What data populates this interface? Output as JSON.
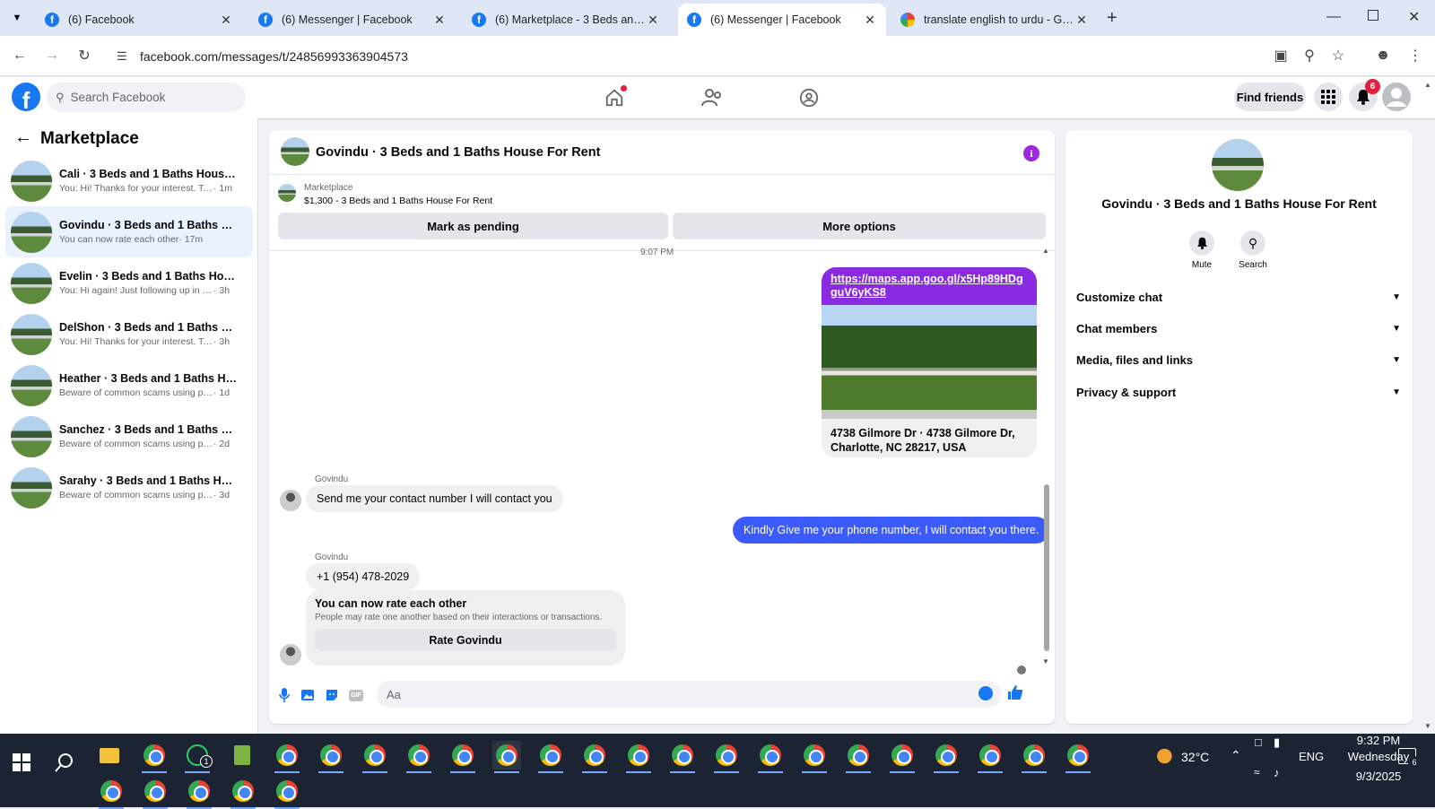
{
  "browser": {
    "tabs": [
      {
        "title": "(6) Facebook",
        "icon": "facebook-icon"
      },
      {
        "title": "(6) Messenger | Facebook",
        "icon": "facebook-icon"
      },
      {
        "title": "(6) Marketplace - 3 Beds and 1",
        "icon": "facebook-icon"
      },
      {
        "title": "(6) Messenger | Facebook",
        "icon": "facebook-icon",
        "active": true
      },
      {
        "title": "translate english to urdu - Goog",
        "icon": "google-icon"
      }
    ],
    "url": "facebook.com/messages/t/24856993363904573"
  },
  "fb_header": {
    "search_placeholder": "Search Facebook",
    "find_friends": "Find friends",
    "notification_count": "6"
  },
  "left_panel": {
    "title": "Marketplace",
    "conversations": [
      {
        "name": "Cali · 3 Beds and 1 Baths House For Rent",
        "preview": "You: Hi! Thanks for your interest. To s...",
        "time": "· 1m"
      },
      {
        "name": "Govindu · 3 Beds and 1 Baths House For Rent",
        "preview": "You can now rate each other",
        "time": "· 17m"
      },
      {
        "name": "Evelin · 3 Beds and 1 Baths House For Rent",
        "preview": "You: Hi again! Just following up in cas...",
        "time": "· 3h"
      },
      {
        "name": "DelShon · 3 Beds and 1 Baths House For Rent",
        "preview": "You: Hi! Thanks for your interest. To sh...",
        "time": "· 3h"
      },
      {
        "name": "Heather · 3 Beds and 1 Baths House For Rent",
        "preview": "Beware of common scams using pay...",
        "time": "· 1d"
      },
      {
        "name": "Sanchez · 3 Beds and 1 Baths House For Rent",
        "preview": "Beware of common scams using pay...",
        "time": "· 2d"
      },
      {
        "name": "Sarahy · 3 Beds and 1 Baths House For Rent",
        "preview": "Beware of common scams using pay...",
        "time": "· 3d"
      }
    ]
  },
  "chat": {
    "title": "Govindu · 3 Beds and 1 Baths House For Rent",
    "listing_label": "Marketplace",
    "listing_detail": "$1,300 - 3 Beds and 1 Baths House For Rent",
    "mark_pending": "Mark as pending",
    "more_options": "More options",
    "timestamp": "9:07 PM",
    "link_message": "https://maps.app.goo.gl/x5Hp89HDgguV6yKS8",
    "link_caption": "4738 Gilmore Dr · 4738 Gilmore Dr, Charlotte, NC 28217, USA",
    "sender1": "Govindu",
    "msg1": "Send me your contact number I will contact you",
    "msg2": "Kindly Give me your phone number, I will contact you there.",
    "sender2": "Govindu",
    "msg3": "+1 (954) 478-2029",
    "rate_title": "You can now rate each other",
    "rate_desc": "People may rate one another based on their interactions or transactions.",
    "rate_button": "Rate Govindu",
    "composer_placeholder": "Aa"
  },
  "right_panel": {
    "title": "Govindu · 3 Beds and 1 Baths House For Rent",
    "mute": "Mute",
    "search": "Search",
    "sections": [
      "Customize chat",
      "Chat members",
      "Media, files and links",
      "Privacy & support"
    ]
  },
  "taskbar": {
    "temperature": "32°C",
    "language": "ENG",
    "time": "9:32 PM",
    "day": "Wednesday",
    "date": "9/3/2025",
    "whatsapp_badge": "1",
    "notif_badge": "6"
  },
  "colors": {
    "fb_blue": "#1877f2",
    "outgoing_bubble": "#3c5bff",
    "link_bubble": "#8a2be2",
    "info_purple": "#9c27e0"
  }
}
